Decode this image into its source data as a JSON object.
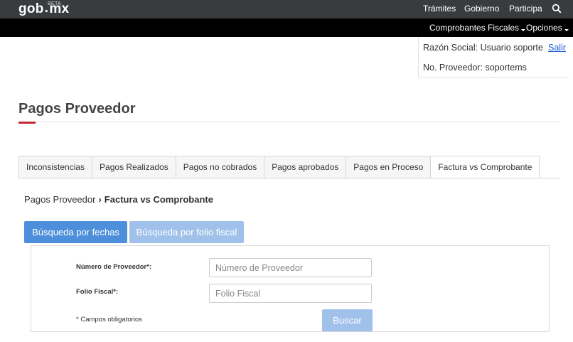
{
  "header": {
    "logo_text_a": "gob",
    "logo_dot": ".",
    "logo_text_b": "mx",
    "logo_badge": "BETA",
    "nav": [
      "Trámites",
      "Gobierno",
      "Participa"
    ]
  },
  "subheader": {
    "menu_comprobantes": "Comprobantes Fiscales",
    "menu_opciones": "Opciones"
  },
  "user": {
    "razon_social": "Razón Social: Usuario soporte",
    "salir": "Salir",
    "proveedor": "No. Proveedor: soportems"
  },
  "page": {
    "title": "Pagos Proveedor"
  },
  "tabs": [
    "Inconsistencias",
    "Pagos Realizados",
    "Pagos no cobrados",
    "Pagos aprobados",
    "Pagos en Proceso",
    "Factura vs Comprobante"
  ],
  "breadcrumb": {
    "parent": "Pagos Proveedor",
    "separator": "›",
    "current": "Factura vs Comprobante"
  },
  "search_tabs": {
    "fechas": "Búsqueda por fechas",
    "folio": "Búsqueda por folio fiscal"
  },
  "form": {
    "numero_label": "Número de Proveedor*:",
    "numero_placeholder": "Número de Proveedor",
    "numero_value": "",
    "folio_label": "Folio Fiscal*:",
    "folio_placeholder": "Folio Fiscal",
    "folio_value": "",
    "note": "* Campos obligatorios",
    "buscar": "Buscar"
  },
  "colors": {
    "topbar": "#393c3e",
    "subbar": "#000000",
    "accent_red": "#c22b34",
    "primary_blue": "#4d8fda",
    "light_blue": "#9fc1ea",
    "link": "#1a5bd6"
  }
}
